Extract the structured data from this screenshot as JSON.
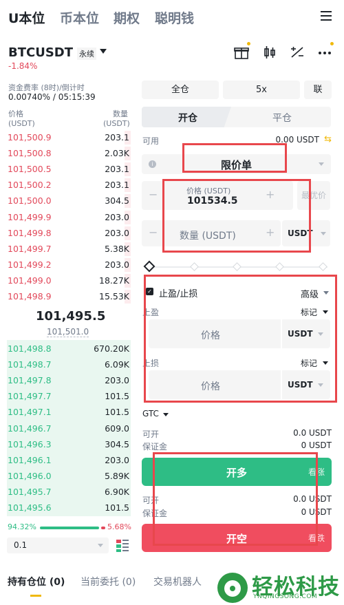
{
  "top_tabs": [
    "U本位",
    "币本位",
    "期权",
    "聪明钱"
  ],
  "symbol": {
    "name": "BTCUSDT",
    "type": "永续",
    "change": "-1.84%"
  },
  "funding": {
    "label": "资金费率 (8时)/倒计时",
    "value": "0.00740% / 05:15:39"
  },
  "orderbook": {
    "price_header": "价格",
    "price_unit": "(USDT)",
    "qty_header": "数量",
    "qty_unit": "(USDT)",
    "asks": [
      {
        "price": "101,500.9",
        "qty": "203.1",
        "depth": 0.05
      },
      {
        "price": "101,500.8",
        "qty": "2.03K",
        "depth": 0.05
      },
      {
        "price": "101,500.5",
        "qty": "203.1",
        "depth": 0.05
      },
      {
        "price": "101,500.2",
        "qty": "203.1",
        "depth": 0.05
      },
      {
        "price": "101,500.0",
        "qty": "304.5",
        "depth": 0.05
      },
      {
        "price": "101,499.9",
        "qty": "203.0",
        "depth": 0.05
      },
      {
        "price": "101,499.8",
        "qty": "203.0",
        "depth": 0.05
      },
      {
        "price": "101,499.7",
        "qty": "5.38K",
        "depth": 0.05
      },
      {
        "price": "101,499.2",
        "qty": "203.0",
        "depth": 0.05
      },
      {
        "price": "101,499.0",
        "qty": "18.27K",
        "depth": 0.05
      },
      {
        "price": "101,498.9",
        "qty": "15.53K",
        "depth": 0.05
      }
    ],
    "mid_price": "101,495.5",
    "mark_price": "101,501.0",
    "bids": [
      {
        "price": "101,498.8",
        "qty": "670.20K"
      },
      {
        "price": "101,498.7",
        "qty": "6.09K"
      },
      {
        "price": "101,497.8",
        "qty": "203.0"
      },
      {
        "price": "101,497.7",
        "qty": "101.5"
      },
      {
        "price": "101,497.1",
        "qty": "101.5"
      },
      {
        "price": "101,496.7",
        "qty": "609.0"
      },
      {
        "price": "101,496.3",
        "qty": "304.5"
      },
      {
        "price": "101,496.1",
        "qty": "203.0"
      },
      {
        "price": "101,496.0",
        "qty": "5.89K"
      },
      {
        "price": "101,495.7",
        "qty": "6.90K"
      },
      {
        "price": "101,495.6",
        "qty": "101.5"
      }
    ],
    "buy_ratio": "94.32%",
    "sell_ratio": "5.68%",
    "buy_fraction": 0.9432,
    "depth_step": "0.1"
  },
  "trade": {
    "margin_mode": "全仓",
    "leverage": "5x",
    "asset_mode": "联",
    "tab_open": "开仓",
    "tab_close": "平仓",
    "available_label": "可用",
    "available_value": "0.00 USDT",
    "order_type": "限价单",
    "price_label": "价格 (USDT)",
    "price_value": "101534.5",
    "best_price": "最优价",
    "qty_placeholder": "数量 (USDT)",
    "qty_unit": "USDT",
    "tpsl_label": "止盈/止损",
    "tpsl_mode": "高级",
    "tp_label": "上盈",
    "tp_trigger": "标记",
    "tp_placeholder": "价格",
    "tp_unit": "USDT",
    "sl_label": "上损",
    "sl_trigger": "标记",
    "sl_placeholder": "价格",
    "sl_unit": "USDT",
    "tif": "GTC",
    "long_can_open_label": "可开",
    "long_can_open_value": "0.0 USDT",
    "long_margin_label": "保证金",
    "long_margin_value": "0 USDT",
    "open_long": "开多",
    "long_sub": "看涨",
    "short_can_open_label": "可开",
    "short_can_open_value": "0.0 USDT",
    "short_margin_label": "保证金",
    "short_margin_value": "0 USDT",
    "open_short": "开空",
    "short_sub": "看跌"
  },
  "bottom_tabs": [
    "持有仓位 (0)",
    "当前委托 (0)",
    "交易机器人"
  ],
  "watermark": {
    "title": "轻松科技",
    "subtitle": "YNQINGSONG.COM"
  },
  "colors": {
    "up": "#2ebd85",
    "down": "#e2485a",
    "accent": "#f0b90b",
    "annotation": "#e8474c"
  }
}
